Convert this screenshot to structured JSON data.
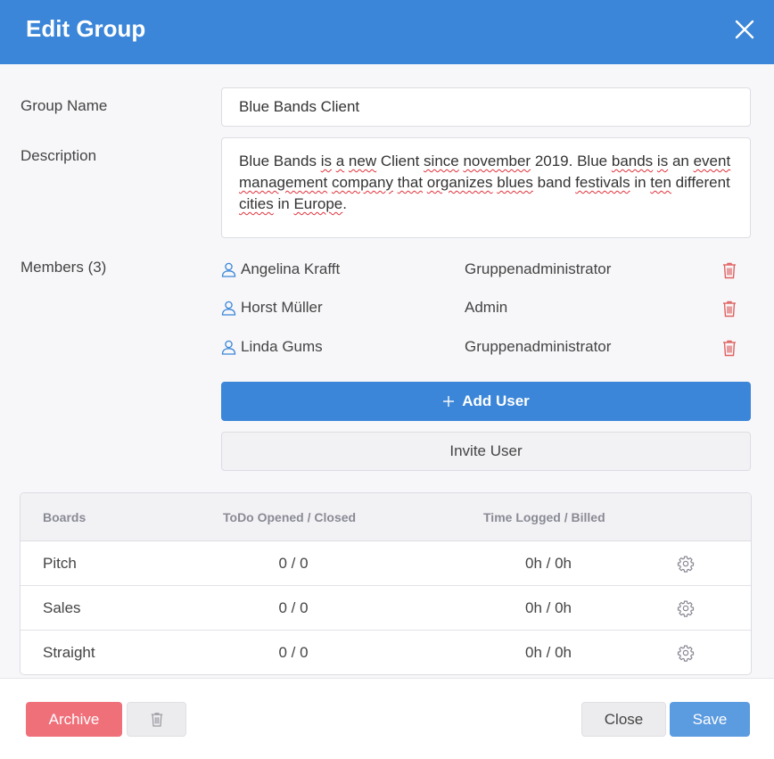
{
  "dialog": {
    "title": "Edit Group"
  },
  "form": {
    "name_label": "Group Name",
    "name_value": "Blue Bands Client",
    "description_label": "Description",
    "description_value": "Blue Bands is a new Client since november 2019. Blue bands is an event management company that organizes blues band festivals in ten different cities in Europe.",
    "members_label": "Members (3)"
  },
  "members": [
    {
      "name": "Angelina Krafft",
      "role": "Gruppenadministrator"
    },
    {
      "name": "Horst Müller",
      "role": "Admin"
    },
    {
      "name": "Linda Gums",
      "role": "Gruppenadministrator"
    }
  ],
  "buttons": {
    "add_user": "Add User",
    "invite_user": "Invite User",
    "archive": "Archive",
    "close": "Close",
    "save": "Save"
  },
  "boards_table": {
    "headers": [
      "Boards",
      "ToDo Opened / Closed",
      "Time Logged / Billed"
    ],
    "rows": [
      {
        "board": "Pitch",
        "todo": "0 / 0",
        "time": "0h / 0h"
      },
      {
        "board": "Sales",
        "todo": "0 / 0",
        "time": "0h / 0h"
      },
      {
        "board": "Straight",
        "todo": "0 / 0",
        "time": "0h / 0h"
      }
    ]
  },
  "icons": {
    "close": "close-icon",
    "member": "user-icon",
    "trash": "trash-icon",
    "plus": "plus-icon",
    "settings": "gear-icon"
  },
  "colors": {
    "header": "#3b86d8",
    "primary": "#3b86d8",
    "danger": "#f0707a",
    "trash": "#e06060",
    "save": "#5b9be0"
  }
}
